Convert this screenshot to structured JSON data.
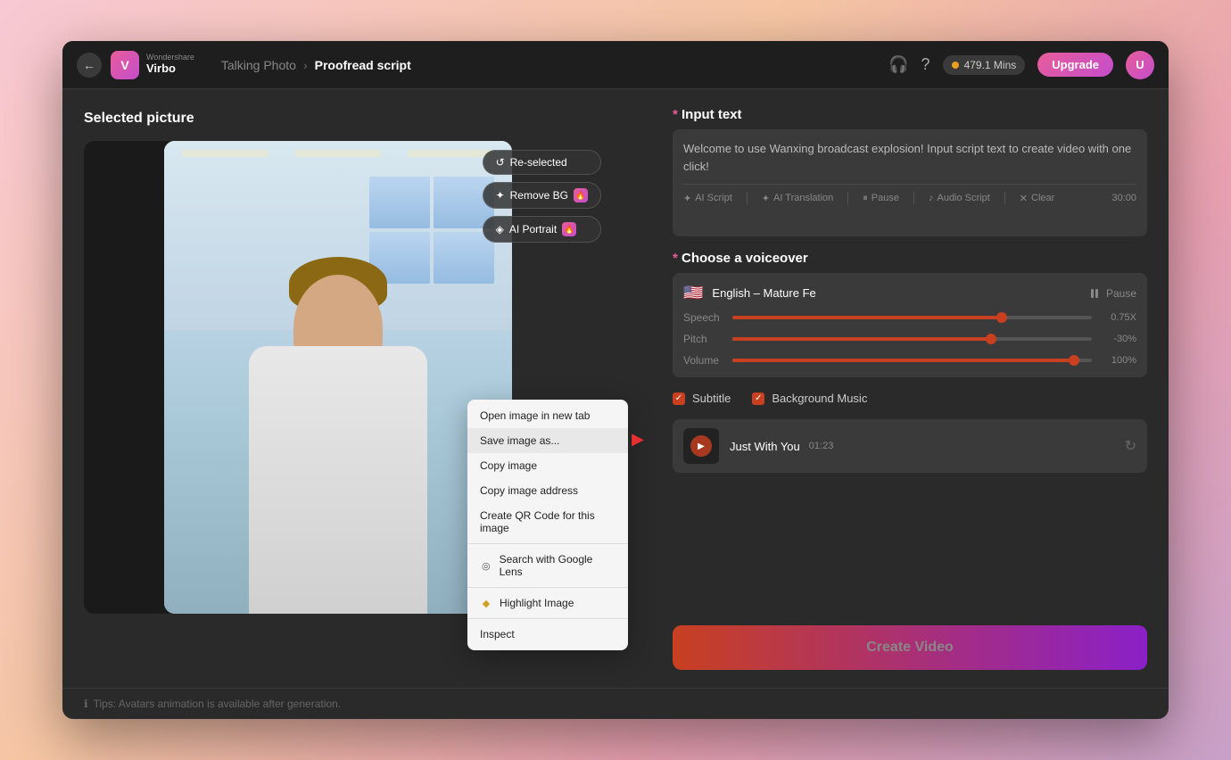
{
  "app": {
    "brand": "Wondershare",
    "product": "Virbo",
    "back_label": "←"
  },
  "header": {
    "breadcrumb_parent": "Talking Photo",
    "breadcrumb_arrow": "›",
    "breadcrumb_current": "Proofread script",
    "mins_label": "479.1 Mins",
    "upgrade_label": "Upgrade",
    "avatar_label": "U"
  },
  "left_panel": {
    "section_title": "Selected picture",
    "overlay_buttons": [
      {
        "label": "Re-selected",
        "icon": "↺",
        "badge": false
      },
      {
        "label": "Remove BG",
        "icon": "✦",
        "badge": true
      },
      {
        "label": "AI Portrait",
        "icon": "◈",
        "badge": true
      }
    ]
  },
  "context_menu": {
    "items": [
      {
        "label": "Open image in new tab",
        "icon": "",
        "divider_after": false
      },
      {
        "label": "Save image as...",
        "icon": "",
        "divider_after": false,
        "highlighted": true
      },
      {
        "label": "Copy image",
        "icon": "",
        "divider_after": false
      },
      {
        "label": "Copy image address",
        "icon": "",
        "divider_after": false
      },
      {
        "label": "Create QR Code for this image",
        "icon": "",
        "divider_after": true
      },
      {
        "label": "Search with Google Lens",
        "icon": "◎",
        "divider_after": false
      },
      {
        "label": "Highlight Image",
        "icon": "◆",
        "divider_after": true
      },
      {
        "label": "Inspect",
        "icon": "",
        "divider_after": false
      }
    ]
  },
  "right_panel": {
    "input_text": {
      "section_title": "Input text",
      "content": "Welcome to use Wanxing broadcast explosion! Input script text to create video with one click!",
      "toolbar": [
        {
          "label": "AI Script",
          "icon": "✦"
        },
        {
          "label": "AI Translation",
          "icon": "✦"
        },
        {
          "label": "Pause",
          "icon": "⏸"
        },
        {
          "label": "Audio Script",
          "icon": "♪"
        },
        {
          "label": "Clear",
          "icon": "✕"
        }
      ],
      "time_label": "30:00"
    },
    "voiceover": {
      "section_title": "Choose a voiceover",
      "flag": "🇺🇸",
      "voice_name": "English – Mature Fe",
      "pause_label": "Pause",
      "sliders": [
        {
          "label": "Speech",
          "fill_pct": 75,
          "thumb_pct": 75,
          "value": "0.75X"
        },
        {
          "label": "Pitch",
          "fill_pct": 72,
          "thumb_pct": 72,
          "value": "-30%"
        },
        {
          "label": "Volume",
          "fill_pct": 95,
          "thumb_pct": 95,
          "value": "100%"
        }
      ]
    },
    "subtitle": {
      "label": "Subtitle",
      "checked": true
    },
    "background_music": {
      "label": "Background Music",
      "checked": true,
      "track": {
        "title": "Just With You",
        "duration": "01:23"
      }
    },
    "create_button": "Create Video"
  },
  "footer": {
    "tip": "Tips: Avatars animation is available after generation."
  }
}
